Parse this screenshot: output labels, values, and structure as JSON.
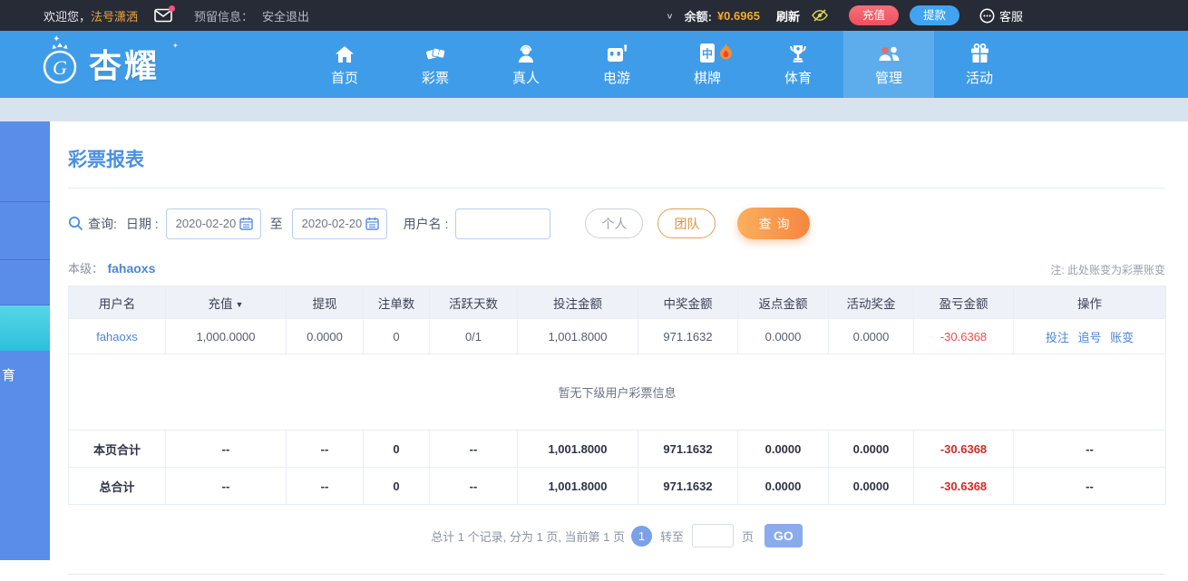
{
  "icons": {
    "chevron_down": "∨",
    "sort_desc": "▼"
  },
  "colors": {
    "nav_blue": "#3f9ce9",
    "accent_orange": "#f5a832",
    "deposit_red": "#ef4f5b",
    "withdraw_blue": "#42a4f1",
    "link_blue": "#4a86d8",
    "negative_red": "#e25050",
    "active_cyan": "#3ac9e0",
    "title_blue": "#4a90e2"
  },
  "topbar": {
    "welcome_prefix": "欢迎您，",
    "username": "法号潇洒",
    "reserved_label": "预留信息：",
    "logout": "安全退出",
    "balance_label": "余额:",
    "balance_value": "¥0.6965",
    "refresh": "刷新",
    "deposit": "充值",
    "withdraw": "提款",
    "service": "客服"
  },
  "nav": {
    "logo_text": "杏耀",
    "items": [
      {
        "label": "首页"
      },
      {
        "label": "彩票"
      },
      {
        "label": "真人"
      },
      {
        "label": "电游"
      },
      {
        "label": "棋牌"
      },
      {
        "label": "体育"
      },
      {
        "label": "管理"
      },
      {
        "label": "活动"
      }
    ],
    "mahjong_char": "中"
  },
  "sidebar": {
    "visible_item_label": "育"
  },
  "page": {
    "title": "彩票报表",
    "query_label": "查询:",
    "date_label": "日期 :",
    "date_from": "2020-02-20",
    "to_label": "至",
    "date_to": "2020-02-20",
    "username_label": "用户名 :",
    "personal_btn": "个人",
    "team_btn": "团队",
    "search_btn": "查询",
    "level_label": "本级：",
    "level_user": "fahaoxs",
    "note": "注: 此处账变为彩票账变"
  },
  "table": {
    "headers": [
      "用户名",
      "充值",
      "提现",
      "注单数",
      "活跃天数",
      "投注金额",
      "中奖金额",
      "返点金额",
      "活动奖金",
      "盈亏金额",
      "操作"
    ],
    "rows": [
      [
        "fahaoxs",
        "1,000.0000",
        "0.0000",
        "0",
        "0/1",
        "1,001.8000",
        "971.1632",
        "0.0000",
        "0.0000",
        "-30.6368"
      ]
    ],
    "row_actions": [
      "投注",
      "追号",
      "账变"
    ],
    "empty_text": "暂无下级用户彩票信息",
    "page_total_label": "本页合计",
    "page_total": [
      "--",
      "--",
      "0",
      "--",
      "1,001.8000",
      "971.1632",
      "0.0000",
      "0.0000",
      "-30.6368",
      "--"
    ],
    "grand_total_label": "总合计",
    "grand_total": [
      "--",
      "--",
      "0",
      "--",
      "1,001.8000",
      "971.1632",
      "0.0000",
      "0.0000",
      "-30.6368",
      "--"
    ]
  },
  "pagination": {
    "summary": "总计 1 个记录, 分为 1 页, 当前第 1 页",
    "current_page": "1",
    "goto_label": "转至",
    "page_unit": "页",
    "go_btn": "GO"
  }
}
